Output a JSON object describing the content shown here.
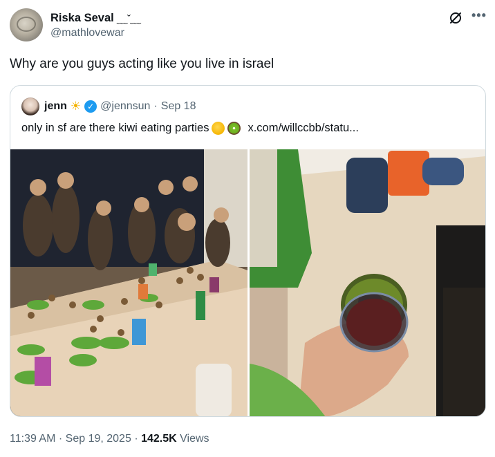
{
  "author": {
    "name": "Riska Seval",
    "name_decoration": "﹏ˇ﹏",
    "handle": "@mathlovewar"
  },
  "tweet": {
    "text": "Why are you guys acting like you live in israel"
  },
  "quoted": {
    "name": "jenn",
    "name_emoji": "☀",
    "handle": "@jennsun",
    "separator": "·",
    "date": "Sep 18",
    "text": "only in sf are there kiwi eating parties",
    "link": "x.com/willccbb/statu..."
  },
  "meta": {
    "time": "11:39 AM",
    "date": "Sep 19, 2025",
    "views_count": "142.5K",
    "views_label": "Views",
    "separator": "·"
  },
  "icons": {
    "grok": "grok-icon",
    "more": "more-icon",
    "verified": "verified-badge-icon"
  },
  "colors": {
    "text_primary": "#0f1419",
    "text_secondary": "#536471",
    "border": "#cfd9de",
    "verified": "#1d9bf0"
  }
}
